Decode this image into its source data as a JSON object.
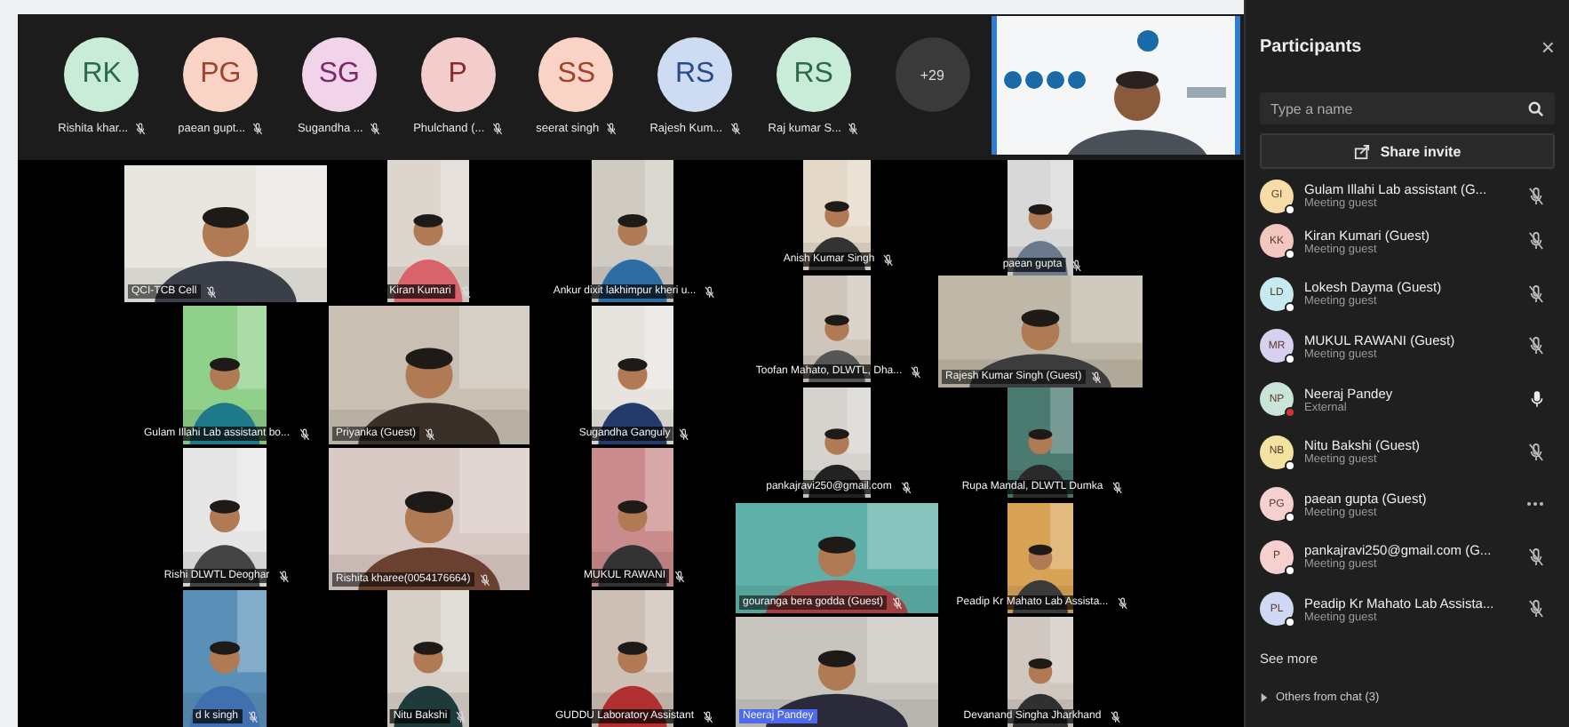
{
  "top_strip": {
    "avatars": [
      {
        "initials": "RK",
        "name": "Rishita khar...",
        "color": "#c9ecd9"
      },
      {
        "initials": "PG",
        "name": "paean gupt...",
        "color": "#f9d3c6"
      },
      {
        "initials": "SG",
        "name": "Sugandha ...",
        "color": "#f1d3ea"
      },
      {
        "initials": "P",
        "name": "Phulchand (...",
        "color": "#f3cccc"
      },
      {
        "initials": "SS",
        "name": "seerat singh",
        "color": "#f9d3c6"
      },
      {
        "initials": "RS",
        "name": "Rajesh Kum...",
        "color": "#cddcf3"
      },
      {
        "initials": "RS",
        "name": "Raj kumar S...",
        "color": "#c9ecd9"
      }
    ],
    "overflow": "+29"
  },
  "gallery": [
    {
      "name": "QCI-TCB Cell",
      "highlighted": false
    },
    {
      "name": "Kiran Kumari",
      "highlighted": false
    },
    {
      "name": "Ankur dixit lakhimpur kheri u...",
      "highlighted": false
    },
    {
      "name": "Anish Kumar Singh",
      "highlighted": false
    },
    {
      "name": "paean gupta",
      "highlighted": false
    },
    {
      "name": "Gulam Illahi Lab assistant bo...",
      "highlighted": false
    },
    {
      "name": "Priyanka (Guest)",
      "highlighted": false
    },
    {
      "name": "Sugandha Ganguly",
      "highlighted": false
    },
    {
      "name": "Toofan Mahato, DLWTL, Dha...",
      "highlighted": false
    },
    {
      "name": "Rajesh Kumar Singh (Guest)",
      "highlighted": false
    },
    {
      "name": "Rishi DLWTL Deoghar",
      "highlighted": false
    },
    {
      "name": "Rishita kharee(0054176664)",
      "highlighted": false
    },
    {
      "name": "MUKUL RAWANI",
      "highlighted": false
    },
    {
      "name": "pankajravi250@gmail.com",
      "highlighted": false
    },
    {
      "name": "Rupa Mandal, DLWTL Dumka",
      "highlighted": false
    },
    {
      "name": "gouranga bera godda (Guest)",
      "highlighted": false
    },
    {
      "name": "Peadip Kr Mahato Lab Assista...",
      "highlighted": false
    },
    {
      "name": "d k singh",
      "highlighted": false
    },
    {
      "name": "Nitu Bakshi",
      "highlighted": false
    },
    {
      "name": "GUDDU Laboratory Assistant",
      "highlighted": false
    },
    {
      "name": "Neeraj Pandey",
      "highlighted": true
    },
    {
      "name": "Devanand Singha Jharkhand",
      "highlighted": false
    }
  ],
  "panel": {
    "title": "Participants",
    "close": "×",
    "search": {
      "placeholder": "Type a name"
    },
    "share_button": "Share invite",
    "participants": [
      {
        "initials": "GI",
        "name": "Gulam Illahi Lab assistant (G...",
        "role": "Meeting guest",
        "color": "#f6dca6",
        "busy": false,
        "kind": "muted"
      },
      {
        "initials": "KK",
        "name": "Kiran Kumari (Guest)",
        "role": "Meeting guest",
        "color": "#f3c6c0",
        "busy": false,
        "kind": "muted"
      },
      {
        "initials": "LD",
        "name": "Lokesh Dayma (Guest)",
        "role": "Meeting guest",
        "color": "#c5eaf0",
        "busy": false,
        "kind": "muted"
      },
      {
        "initials": "MR",
        "name": "MUKUL RAWANI (Guest)",
        "role": "Meeting guest",
        "color": "#d8d0ef",
        "busy": false,
        "kind": "muted"
      },
      {
        "initials": "NP",
        "name": "Neeraj Pandey",
        "role": "External",
        "color": "#c9e4d8",
        "busy": true,
        "kind": "unmuted"
      },
      {
        "initials": "NB",
        "name": "Nitu Bakshi (Guest)",
        "role": "Meeting guest",
        "color": "#f4e3a0",
        "busy": false,
        "kind": "muted"
      },
      {
        "initials": "PG",
        "name": "paean gupta (Guest)",
        "role": "Meeting guest",
        "color": "#f6cfcf",
        "busy": false,
        "kind": "menu"
      },
      {
        "initials": "P",
        "name": "pankajravi250@gmail.com (G...",
        "role": "Meeting guest",
        "color": "#f6cfcf",
        "busy": false,
        "kind": "muted"
      },
      {
        "initials": "PL",
        "name": "Peadip Kr Mahato Lab Assista...",
        "role": "Meeting guest",
        "color": "#cfd9f3",
        "busy": false,
        "kind": "muted"
      }
    ],
    "see_more": "See more",
    "others": "Others from chat (3)"
  }
}
